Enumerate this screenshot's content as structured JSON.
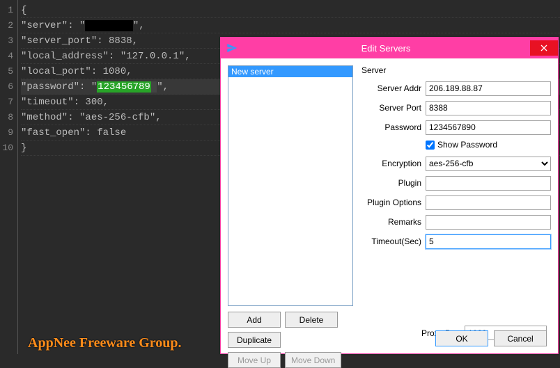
{
  "editor": {
    "lines": [
      "{",
      "\"server\": \"",
      "\"server_port\": 8838,",
      "\"local_address\": \"127.0.0.1\",",
      "\"local_port\": 1080,",
      "\"password\": \"",
      "\"timeout\": 300,",
      "\"method\": \"aes-256-cfb\",",
      "\"fast_open\": false",
      "}"
    ],
    "server_redacted": true,
    "password_highlight": "123456789",
    "password_tail": "\",",
    "active_line_index": 5,
    "line_count": 10
  },
  "watermark": "AppNee Freeware Group.",
  "dialog": {
    "title": "Edit Servers",
    "list": {
      "selected": "New server"
    },
    "group_label": "Server",
    "labels": {
      "server_addr": "Server Addr",
      "server_port": "Server Port",
      "password": "Password",
      "show_password": "Show Password",
      "encryption": "Encryption",
      "plugin": "Plugin",
      "plugin_options": "Plugin Options",
      "remarks": "Remarks",
      "timeout": "Timeout(Sec)",
      "proxy_port": "Proxy Port"
    },
    "values": {
      "server_addr": "206.189.88.87",
      "server_port": "8388",
      "password": "1234567890",
      "show_password": true,
      "encryption": "aes-256-cfb",
      "plugin": "",
      "plugin_options": "",
      "remarks": "",
      "timeout": "5",
      "proxy_port": "1080"
    },
    "buttons": {
      "add": "Add",
      "delete": "Delete",
      "duplicate": "Duplicate",
      "move_up": "Move Up",
      "move_down": "Move Down",
      "ok": "OK",
      "cancel": "Cancel"
    }
  }
}
